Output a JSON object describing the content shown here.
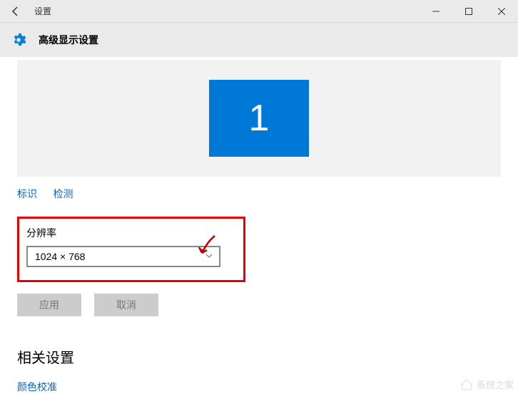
{
  "titlebar": {
    "title": "设置"
  },
  "header": {
    "title": "高级显示设置"
  },
  "monitor": {
    "number": "1"
  },
  "links": {
    "identify": "标识",
    "detect": "检测"
  },
  "resolution": {
    "label": "分辨率",
    "value": "1024 × 768"
  },
  "buttons": {
    "apply": "应用",
    "cancel": "取消"
  },
  "related": {
    "heading": "相关设置",
    "color_calibration": "颜色校准"
  },
  "watermark": {
    "text": "系统之家"
  }
}
